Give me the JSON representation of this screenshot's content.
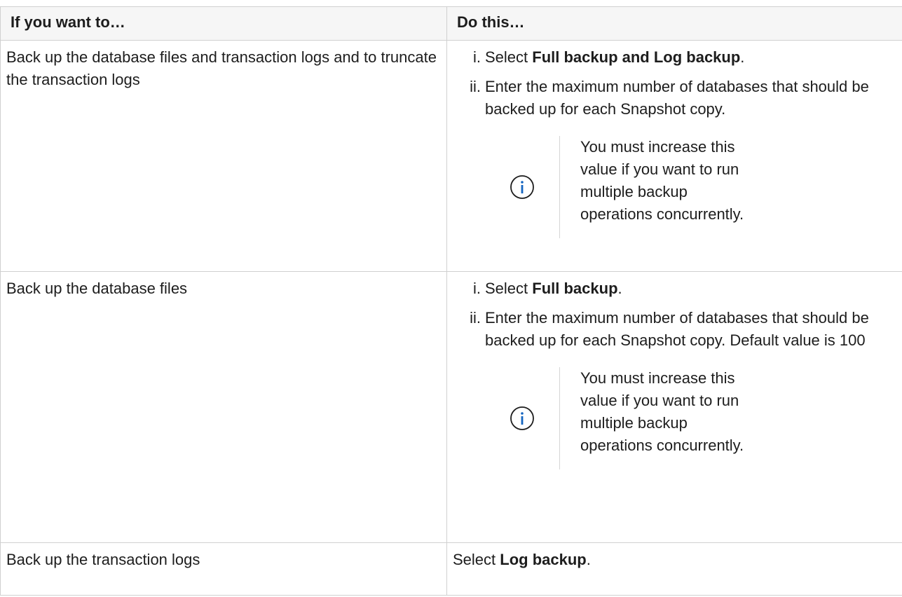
{
  "table": {
    "headers": [
      "If you want to…",
      "Do this…"
    ],
    "rows": [
      {
        "want": "Back up the database files and transaction logs and to truncate the transaction logs",
        "steps": [
          {
            "marker": "i.",
            "pre": "Select ",
            "bold": "Full backup and Log backup",
            "post": "."
          },
          {
            "marker": "ii.",
            "text": "Enter the maximum number of databases that should be backed up for each Snapshot copy."
          }
        ],
        "note": "You must increase this value if you want to run multiple backup operations concurrently."
      },
      {
        "want": "Back up the database files",
        "steps": [
          {
            "marker": "i.",
            "pre": "Select ",
            "bold": "Full backup",
            "post": "."
          },
          {
            "marker": "ii.",
            "text": "Enter the maximum number of databases that should be backed up for each Snapshot copy. Default value is 100"
          }
        ],
        "note": "You must increase this value if you want to run multiple backup operations concurrently."
      },
      {
        "want": "Back up the transaction logs",
        "pre": "Select ",
        "bold": "Log backup",
        "post": "."
      }
    ]
  },
  "icons": {
    "note_icon": "info-circle-icon",
    "accent_color": "#1565c0"
  }
}
